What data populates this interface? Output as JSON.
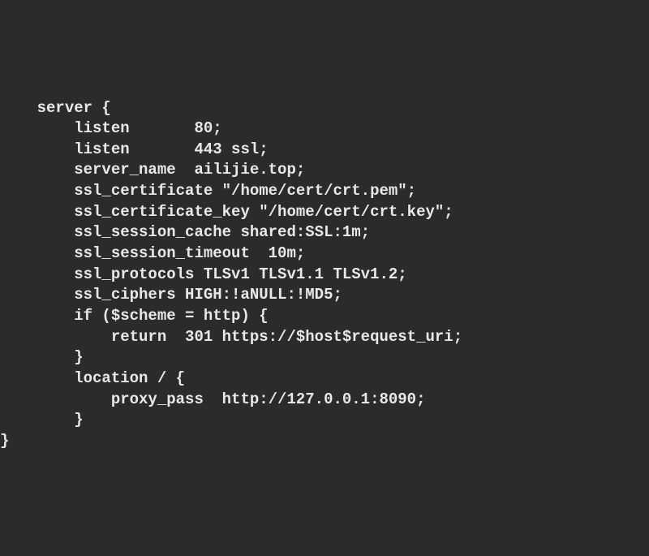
{
  "code": {
    "lines": [
      "    server {",
      "        listen       80;",
      "        listen       443 ssl;",
      "        server_name  ailijie.top;",
      "",
      "        ssl_certificate \"/home/cert/crt.pem\";",
      "        ssl_certificate_key \"/home/cert/crt.key\";",
      "        ssl_session_cache shared:SSL:1m;",
      "        ssl_session_timeout  10m;",
      "        ssl_protocols TLSv1 TLSv1.1 TLSv1.2;",
      "        ssl_ciphers HIGH:!aNULL:!MD5;",
      "        if ($scheme = http) {",
      "            return  301 https://$host$request_uri;",
      "        }",
      "",
      "        location / {",
      "            proxy_pass  http://127.0.0.1:8090;",
      "        }",
      "}"
    ]
  }
}
